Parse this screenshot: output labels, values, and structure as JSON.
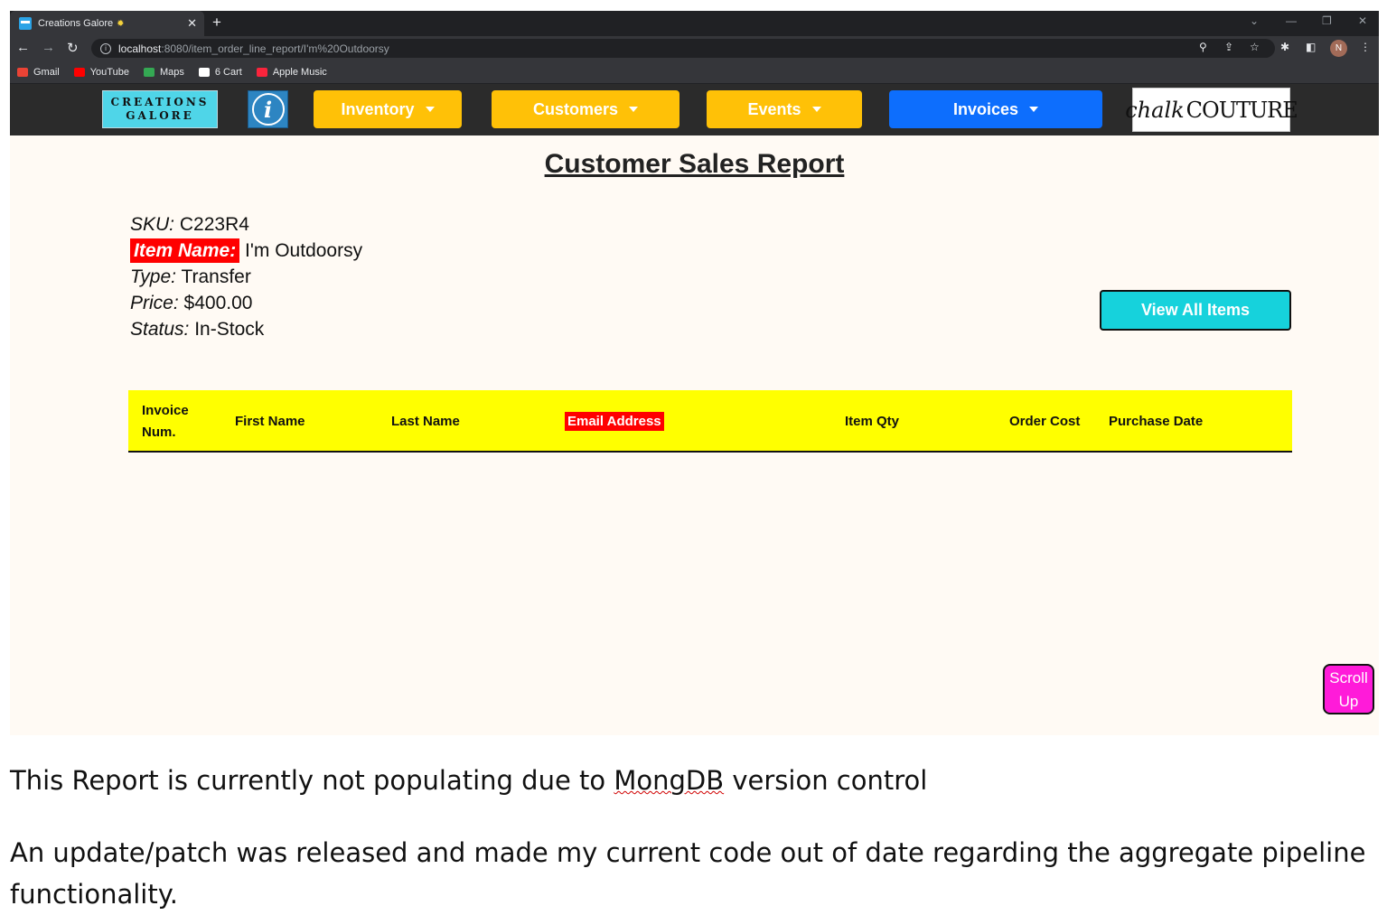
{
  "browser": {
    "tab_title": "Creations Galore",
    "tab_sparkle": "✹",
    "url_host": "localhost",
    "url_path": ":8080/item_order_line_report/I'm%20Outdoorsy",
    "profile_initial": "N",
    "bookmarks": [
      {
        "label": "Gmail",
        "color": "#ea4335"
      },
      {
        "label": "YouTube",
        "color": "#ff0000"
      },
      {
        "label": "Maps",
        "color": "#34a853"
      },
      {
        "label": "6 Cart",
        "color": "#ffffff"
      },
      {
        "label": "Apple Music",
        "color": "#fa243c"
      }
    ]
  },
  "navbar": {
    "logo_line1": "CREATIONS",
    "logo_line2": "GALORE",
    "info_glyph": "i",
    "inventory": "Inventory",
    "customers": "Customers",
    "events": "Events",
    "invoices": "Invoices",
    "brand_script": "chalk",
    "brand_caps": "COUTURE",
    "colors": {
      "yellow": "#ffc107",
      "blue": "#0d6efd"
    }
  },
  "report": {
    "title": "Customer Sales Report",
    "sku_label": "SKU:",
    "sku_value": "C223R4",
    "item_name_label": "Item Name:",
    "item_name_value": "I'm Outdoorsy",
    "type_label": "Type:",
    "type_value": "Transfer",
    "price_label": "Price:",
    "price_value": "$400.00",
    "status_label": "Status:",
    "status_value": "In-Stock",
    "view_all_label": "View All Items",
    "columns": {
      "invoice_line1": "Invoice",
      "invoice_line2": "Num.",
      "first_name": "First Name",
      "last_name": "Last Name",
      "email": "Email Address",
      "item_qty": "Item Qty",
      "order_cost": "Order Cost",
      "purchase_date": "Purchase Date"
    },
    "scroll_up_line1": "Scroll",
    "scroll_up_line2": "Up"
  },
  "caption": {
    "line1_before": "This Report is currently not populating due to ",
    "line1_term": "MongDB",
    "line1_after": " version control",
    "line2": "An update/patch was released and made my current code out of date regarding the aggregate pipeline functionality."
  }
}
